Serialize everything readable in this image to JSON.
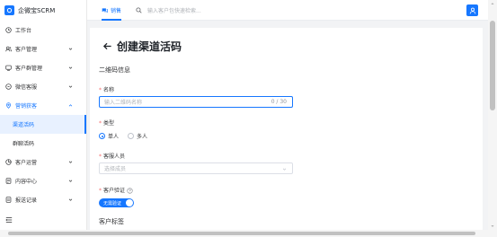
{
  "app": {
    "brand_name": "企微宝SCRM"
  },
  "colors": {
    "accent": "#1677ff",
    "required": "#f56c6c"
  },
  "sidebar": {
    "items": [
      {
        "label": "工作台",
        "icon": "clock-icon",
        "chevron": false
      },
      {
        "label": "客户管理",
        "icon": "users-icon",
        "chevron": true
      },
      {
        "label": "客户群管理",
        "icon": "group-icon",
        "chevron": true
      },
      {
        "label": "微信客服",
        "icon": "headset-icon",
        "chevron": true
      },
      {
        "label": "营销获客",
        "icon": "location-icon",
        "chevron": true,
        "expanded": true
      }
    ],
    "subitems": [
      {
        "label": "渠道活码",
        "selected": true
      },
      {
        "label": "群聊活码",
        "selected": false
      }
    ],
    "items_after": [
      {
        "label": "客户运营",
        "icon": "chart-icon",
        "chevron": true
      },
      {
        "label": "内容中心",
        "icon": "content-icon",
        "chevron": true
      },
      {
        "label": "报送记录",
        "icon": "report-icon",
        "chevron": true
      }
    ],
    "collapse_icon": "menu-collapse-icon"
  },
  "topbar": {
    "tab_label": "销售",
    "search_placeholder": "输入客户包快速检索...",
    "avatar_icon": "user-icon"
  },
  "page": {
    "title": "创建渠道活码",
    "section_qr": "二维码信息",
    "name": {
      "label": "名称",
      "placeholder": "输入二维码名称",
      "count": "0 / 30"
    },
    "type": {
      "label": "类型",
      "options": [
        "单人",
        "多人"
      ],
      "selected": "单人"
    },
    "agent": {
      "label": "客服人员",
      "placeholder": "选择成员"
    },
    "verify": {
      "label": "客户验证",
      "switch_text": "无需验证",
      "on": true
    },
    "section_tags": "客户标签"
  }
}
